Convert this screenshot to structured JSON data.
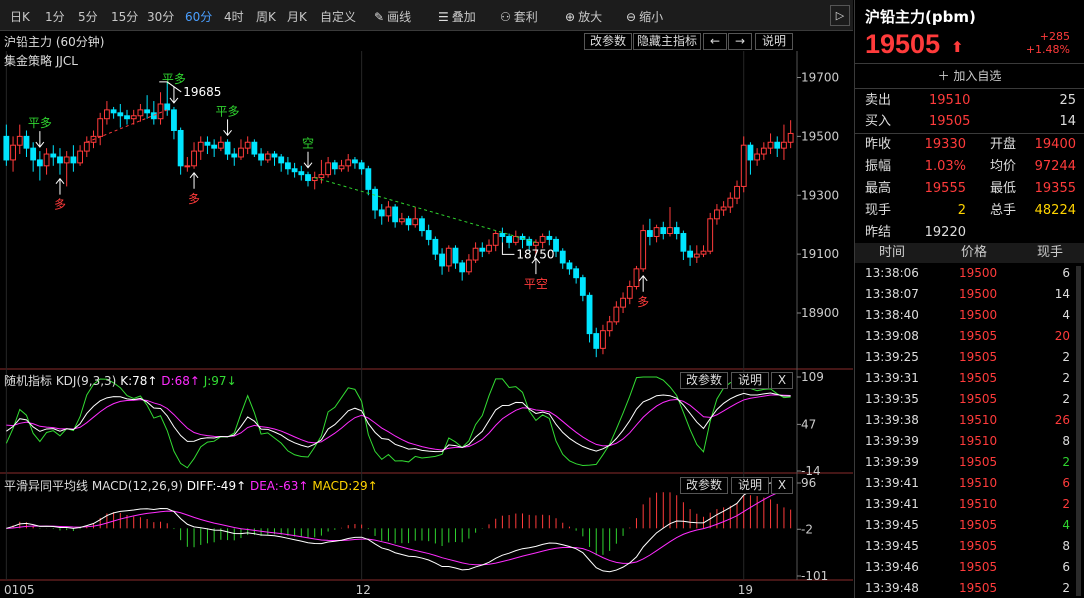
{
  "toolbar": {
    "periods": [
      "日K",
      "1分",
      "5分",
      "15分",
      "30分",
      "60分",
      "4时",
      "周K",
      "月K",
      "自定义"
    ],
    "active_period": "60分",
    "tools": [
      {
        "icon": "pencil-icon",
        "glyph": "✎",
        "label": "画线"
      },
      {
        "icon": "layers-icon",
        "glyph": "☰",
        "label": "叠加"
      },
      {
        "icon": "arbitrage-icon",
        "glyph": "⚇",
        "label": "套利"
      },
      {
        "icon": "zoom-in-icon",
        "glyph": "⊕",
        "label": "放大"
      },
      {
        "icon": "zoom-out-icon",
        "glyph": "⊖",
        "label": "缩小"
      }
    ],
    "collapse": "▷"
  },
  "main_panel": {
    "title": "沪铅主力 (60分钟)",
    "strategy": "集金策略 JJCL",
    "buttons": [
      "改参数",
      "隐藏主指标",
      "←",
      "→",
      "说明"
    ]
  },
  "kdj_panel": {
    "title": "随机指标 KDJ(9,3,3)",
    "k": "K:78↑",
    "d": "D:68↑",
    "j": "J:97↓",
    "buttons": [
      "改参数",
      "说明",
      "X"
    ]
  },
  "macd_panel": {
    "title": "平滑异同平均线 MACD(12,26,9)",
    "diff": "DIFF:-49↑",
    "dea": "DEA:-63↑",
    "macd": "MACD:29↑",
    "buttons": [
      "改参数",
      "说明",
      "X"
    ]
  },
  "chart_data": {
    "type": "candlestick",
    "y_axis": {
      "ticks": [
        19700,
        19500,
        19300,
        19100,
        18900
      ],
      "min": 18720,
      "max": 19790
    },
    "kdj_axis": {
      "ticks": [
        109,
        47,
        -14
      ],
      "min": -14,
      "max": 109
    },
    "macd_axis": {
      "ticks": [
        96,
        -2,
        -101
      ],
      "min": -101,
      "max": 96
    },
    "x_labels": [
      {
        "i": 0,
        "text": "0105"
      },
      {
        "i": 53,
        "text": "12"
      },
      {
        "i": 110,
        "text": "19"
      }
    ],
    "candles": [
      [
        19500,
        19420,
        19540,
        19400
      ],
      [
        19420,
        19470,
        19500,
        19380
      ],
      [
        19470,
        19500,
        19540,
        19440
      ],
      [
        19500,
        19460,
        19520,
        19430
      ],
      [
        19460,
        19420,
        19480,
        19380
      ],
      [
        19420,
        19400,
        19450,
        19350
      ],
      [
        19400,
        19440,
        19460,
        19370
      ],
      [
        19440,
        19430,
        19470,
        19400
      ],
      [
        19430,
        19410,
        19460,
        19370
      ],
      [
        19410,
        19430,
        19450,
        19330
      ],
      [
        19430,
        19410,
        19470,
        19380
      ],
      [
        19410,
        19450,
        19470,
        19400
      ],
      [
        19450,
        19480,
        19500,
        19430
      ],
      [
        19480,
        19500,
        19520,
        19460
      ],
      [
        19500,
        19560,
        19580,
        19470
      ],
      [
        19560,
        19590,
        19620,
        19540
      ],
      [
        19590,
        19580,
        19600,
        19560
      ],
      [
        19580,
        19570,
        19610,
        19530
      ],
      [
        19570,
        19560,
        19590,
        19540
      ],
      [
        19560,
        19570,
        19590,
        19540
      ],
      [
        19570,
        19590,
        19610,
        19550
      ],
      [
        19590,
        19580,
        19640,
        19560
      ],
      [
        19580,
        19560,
        19620,
        19540
      ],
      [
        19560,
        19610,
        19650,
        19540
      ],
      [
        19610,
        19590,
        19685,
        19570
      ],
      [
        19590,
        19520,
        19600,
        19490
      ],
      [
        19520,
        19400,
        19530,
        19370
      ],
      [
        19400,
        19400,
        19430,
        19380
      ],
      [
        19400,
        19450,
        19480,
        19390
      ],
      [
        19450,
        19480,
        19500,
        19420
      ],
      [
        19480,
        19470,
        19500,
        19440
      ],
      [
        19470,
        19460,
        19490,
        19430
      ],
      [
        19460,
        19480,
        19500,
        19450
      ],
      [
        19480,
        19440,
        19490,
        19420
      ],
      [
        19440,
        19430,
        19460,
        19400
      ],
      [
        19430,
        19460,
        19490,
        19420
      ],
      [
        19460,
        19480,
        19500,
        19440
      ],
      [
        19480,
        19440,
        19490,
        19430
      ],
      [
        19440,
        19420,
        19460,
        19400
      ],
      [
        19420,
        19440,
        19450,
        19410
      ],
      [
        19440,
        19430,
        19450,
        19400
      ],
      [
        19430,
        19410,
        19440,
        19380
      ],
      [
        19410,
        19390,
        19430,
        19370
      ],
      [
        19390,
        19380,
        19410,
        19360
      ],
      [
        19380,
        19370,
        19400,
        19350
      ],
      [
        19370,
        19350,
        19380,
        19330
      ],
      [
        19350,
        19360,
        19380,
        19320
      ],
      [
        19360,
        19370,
        19420,
        19340
      ],
      [
        19370,
        19410,
        19430,
        19360
      ],
      [
        19410,
        19390,
        19420,
        19370
      ],
      [
        19390,
        19400,
        19420,
        19380
      ],
      [
        19400,
        19420,
        19440,
        19380
      ],
      [
        19420,
        19410,
        19430,
        19390
      ],
      [
        19410,
        19390,
        19420,
        19370
      ],
      [
        19390,
        19320,
        19400,
        19300
      ],
      [
        19320,
        19250,
        19330,
        19220
      ],
      [
        19250,
        19230,
        19270,
        19200
      ],
      [
        19230,
        19260,
        19280,
        19210
      ],
      [
        19260,
        19210,
        19270,
        19190
      ],
      [
        19210,
        19220,
        19240,
        19200
      ],
      [
        19220,
        19200,
        19230,
        19180
      ],
      [
        19200,
        19220,
        19260,
        19190
      ],
      [
        19220,
        19180,
        19230,
        19160
      ],
      [
        19180,
        19150,
        19200,
        19130
      ],
      [
        19150,
        19100,
        19160,
        19080
      ],
      [
        19100,
        19060,
        19120,
        19030
      ],
      [
        19060,
        19120,
        19130,
        19040
      ],
      [
        19120,
        19070,
        19130,
        19050
      ],
      [
        19070,
        19040,
        19080,
        19010
      ],
      [
        19040,
        19080,
        19100,
        19030
      ],
      [
        19080,
        19120,
        19140,
        19070
      ],
      [
        19120,
        19110,
        19140,
        19090
      ],
      [
        19110,
        19130,
        19150,
        19100
      ],
      [
        19130,
        19170,
        19180,
        19110
      ],
      [
        19170,
        19160,
        19190,
        19140
      ],
      [
        19160,
        19140,
        19170,
        19120
      ],
      [
        19140,
        19160,
        19180,
        19130
      ],
      [
        19160,
        19150,
        19170,
        19120
      ],
      [
        19150,
        19130,
        19160,
        19110
      ],
      [
        19130,
        19140,
        19150,
        19100
      ],
      [
        19140,
        19160,
        19170,
        19120
      ],
      [
        19160,
        19150,
        19180,
        19130
      ],
      [
        19150,
        19110,
        19160,
        19090
      ],
      [
        19110,
        19070,
        19120,
        19050
      ],
      [
        19070,
        19050,
        19080,
        19030
      ],
      [
        19050,
        19020,
        19060,
        19000
      ],
      [
        19020,
        18960,
        19030,
        18940
      ],
      [
        18960,
        18830,
        18970,
        18800
      ],
      [
        18830,
        18780,
        18850,
        18750
      ],
      [
        18780,
        18840,
        18860,
        18760
      ],
      [
        18840,
        18870,
        18890,
        18820
      ],
      [
        18870,
        18920,
        18940,
        18860
      ],
      [
        18920,
        18950,
        18970,
        18900
      ],
      [
        18950,
        18990,
        19010,
        18930
      ],
      [
        18990,
        19050,
        19060,
        18980
      ],
      [
        19050,
        19180,
        19200,
        19040
      ],
      [
        19180,
        19160,
        19220,
        19130
      ],
      [
        19160,
        19190,
        19200,
        19140
      ],
      [
        19190,
        19170,
        19210,
        19150
      ],
      [
        19170,
        19190,
        19260,
        19160
      ],
      [
        19190,
        19170,
        19210,
        19150
      ],
      [
        19170,
        19110,
        19180,
        19080
      ],
      [
        19110,
        19090,
        19130,
        19060
      ],
      [
        19090,
        19100,
        19130,
        19070
      ],
      [
        19100,
        19110,
        19130,
        19090
      ],
      [
        19110,
        19220,
        19240,
        19100
      ],
      [
        19220,
        19250,
        19270,
        19200
      ],
      [
        19250,
        19260,
        19280,
        19230
      ],
      [
        19260,
        19290,
        19310,
        19240
      ],
      [
        19290,
        19330,
        19350,
        19270
      ],
      [
        19330,
        19470,
        19500,
        19310
      ],
      [
        19470,
        19420,
        19480,
        19370
      ],
      [
        19420,
        19440,
        19460,
        19400
      ],
      [
        19440,
        19460,
        19480,
        19420
      ],
      [
        19460,
        19480,
        19510,
        19440
      ],
      [
        19480,
        19460,
        19500,
        19430
      ],
      [
        19460,
        19480,
        19540,
        19420
      ],
      [
        19480,
        19510,
        19555,
        19460
      ]
    ],
    "annotations": [
      {
        "i": 5,
        "label": "平多",
        "pos": "above",
        "color": "#2fd42f"
      },
      {
        "i": 8,
        "label": "多",
        "pos": "below",
        "color": "#ff3b3b"
      },
      {
        "i": 25,
        "label": "平多",
        "pos": "above",
        "color": "#2fd42f"
      },
      {
        "i": 28,
        "label": "多",
        "pos": "below",
        "color": "#ff3b3b"
      },
      {
        "i": 33,
        "label": "平多",
        "pos": "above",
        "color": "#2fd42f"
      },
      {
        "i": 45,
        "label": "空",
        "pos": "above",
        "color": "#2fd42f"
      },
      {
        "i": 79,
        "label": "平空",
        "pos": "below",
        "color": "#ff3b3b"
      },
      {
        "i": 95,
        "label": "多",
        "pos": "below",
        "color": "#ff3b3b"
      }
    ],
    "high_label": {
      "i": 24,
      "text": "19685"
    },
    "low_label": {
      "i": 74,
      "text": "18750"
    }
  },
  "quote": {
    "title": "沪铅主力(pbm)",
    "price": "19505",
    "arrow": "⬆",
    "change": "+285",
    "pct": "+1.48%",
    "add_watch": "加入自选",
    "sell_label": "卖出",
    "sell_price": "19510",
    "sell_vol": "25",
    "buy_label": "买入",
    "buy_price": "19505",
    "buy_vol": "14",
    "stats": [
      [
        {
          "l": "昨收",
          "v": "19330",
          "c": "red"
        },
        {
          "l": "开盘",
          "v": "19400",
          "c": "red"
        }
      ],
      [
        {
          "l": "振幅",
          "v": "1.03%",
          "c": "red"
        },
        {
          "l": "均价",
          "v": "97244",
          "c": "red"
        }
      ],
      [
        {
          "l": "最高",
          "v": "19555",
          "c": "red"
        },
        {
          "l": "最低",
          "v": "19355",
          "c": "red"
        }
      ],
      [
        {
          "l": "现手",
          "v": "2",
          "c": "yel"
        },
        {
          "l": "总手",
          "v": "48224",
          "c": "yel"
        }
      ],
      [
        {
          "l": "昨结",
          "v": "19220",
          "c": "wht"
        }
      ]
    ],
    "tick_headers": [
      "时间",
      "价格",
      "现手"
    ],
    "ticks": [
      {
        "t": "13:38:06",
        "p": "19500",
        "v": "6",
        "vc": "wht"
      },
      {
        "t": "13:38:07",
        "p": "19500",
        "v": "14",
        "vc": "wht"
      },
      {
        "t": "13:38:40",
        "p": "19500",
        "v": "4",
        "vc": "wht"
      },
      {
        "t": "13:39:08",
        "p": "19505",
        "v": "20",
        "vc": "red"
      },
      {
        "t": "13:39:25",
        "p": "19505",
        "v": "2",
        "vc": "wht"
      },
      {
        "t": "13:39:31",
        "p": "19505",
        "v": "2",
        "vc": "wht"
      },
      {
        "t": "13:39:35",
        "p": "19505",
        "v": "2",
        "vc": "wht"
      },
      {
        "t": "13:39:38",
        "p": "19510",
        "v": "26",
        "vc": "red"
      },
      {
        "t": "13:39:39",
        "p": "19510",
        "v": "8",
        "vc": "wht"
      },
      {
        "t": "13:39:39",
        "p": "19505",
        "v": "2",
        "vc": "grn"
      },
      {
        "t": "13:39:41",
        "p": "19510",
        "v": "6",
        "vc": "red"
      },
      {
        "t": "13:39:41",
        "p": "19510",
        "v": "2",
        "vc": "red"
      },
      {
        "t": "13:39:45",
        "p": "19505",
        "v": "4",
        "vc": "grn"
      },
      {
        "t": "13:39:45",
        "p": "19505",
        "v": "8",
        "vc": "wht"
      },
      {
        "t": "13:39:46",
        "p": "19505",
        "v": "6",
        "vc": "wht"
      },
      {
        "t": "13:39:48",
        "p": "19505",
        "v": "2",
        "vc": "wht"
      }
    ]
  },
  "colors": {
    "up": "#ff3b3b",
    "down": "#00e5ff",
    "k": "#ffffff",
    "d": "#ff2cff",
    "j": "#33dd33"
  }
}
